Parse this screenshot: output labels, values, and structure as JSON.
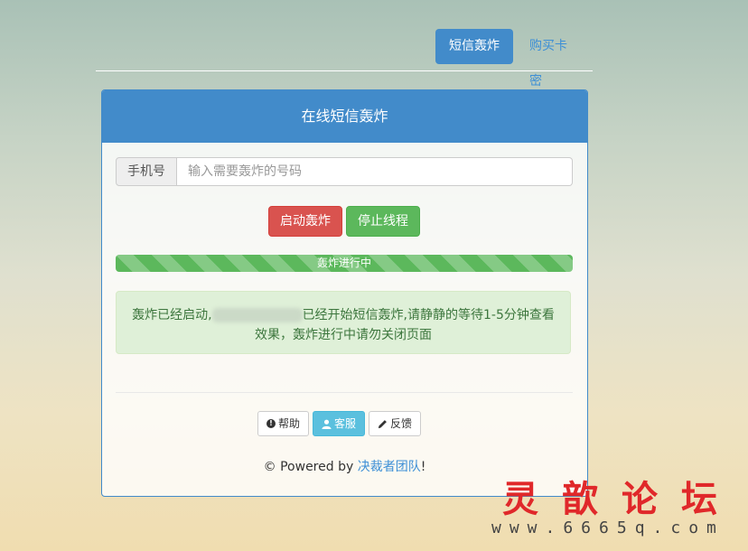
{
  "nav": {
    "tabs": [
      {
        "label": "短信轰炸",
        "active": true
      },
      {
        "label": "购买卡密",
        "active": false
      }
    ]
  },
  "panel": {
    "title": "在线短信轰炸",
    "phone_label": "手机号",
    "phone_placeholder": "输入需要轰炸的号码",
    "start_button": "启动轰炸",
    "stop_button": "停止线程",
    "progress_text": "轰炸进行中",
    "progress": 1.0,
    "alert_prefix": "轰炸已经启动,",
    "alert_suffix": "已经开始短信轰炸,请静静的等待1-5分钟查看效果，轰炸进行中请勿关闭页面",
    "help_button": "帮助",
    "service_button": "客服",
    "feedback_button": "反馈",
    "powered_prefix": "© Powered by ",
    "powered_team": "决裁者团队",
    "powered_suffix": "!"
  },
  "watermark": {
    "text": "灵歆论坛",
    "url": "www.6665q.com"
  },
  "colors": {
    "primary": "#428bca",
    "danger": "#d9534f",
    "success": "#5cb85c",
    "info": "#5bc0de"
  }
}
